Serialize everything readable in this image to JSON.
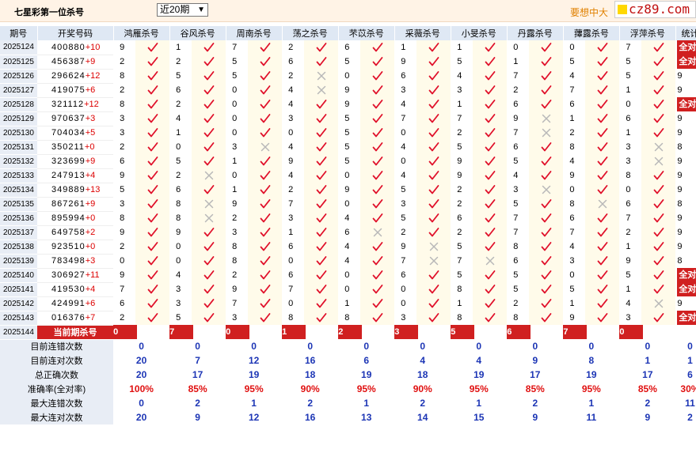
{
  "header": {
    "title": "七星彩第一位杀号",
    "select_value": "近20期",
    "promo": "要想中大",
    "logo": "cz89.com"
  },
  "columns": [
    "期号",
    "开奖号码",
    "鸿雁杀号",
    "谷风杀号",
    "周南杀号",
    "荡之杀号",
    "芣苡杀号",
    "采薇杀号",
    "小旻杀号",
    "丹露杀号",
    "蘀露杀号",
    "浮萍杀号",
    "统计"
  ],
  "rows": [
    {
      "period": "2025124",
      "digits": "400880",
      "sum": "+10",
      "kills": [
        9,
        1,
        7,
        2,
        6,
        1,
        1,
        0,
        0,
        7
      ],
      "ok": [
        1,
        1,
        1,
        1,
        1,
        1,
        1,
        1,
        1,
        1
      ],
      "total": "全对"
    },
    {
      "period": "2025125",
      "digits": "456387",
      "sum": "+9",
      "kills": [
        2,
        2,
        5,
        6,
        5,
        9,
        5,
        1,
        5,
        5
      ],
      "ok": [
        1,
        1,
        1,
        1,
        1,
        1,
        1,
        1,
        1,
        1
      ],
      "total": "全对"
    },
    {
      "period": "2025126",
      "digits": "296624",
      "sum": "+12",
      "kills": [
        8,
        5,
        5,
        2,
        0,
        6,
        4,
        7,
        4,
        5
      ],
      "ok": [
        1,
        1,
        1,
        0,
        1,
        1,
        1,
        1,
        1,
        1
      ],
      "total": "9"
    },
    {
      "period": "2025127",
      "digits": "419075",
      "sum": "+6",
      "kills": [
        2,
        6,
        0,
        4,
        9,
        3,
        3,
        2,
        7,
        1
      ],
      "ok": [
        1,
        1,
        1,
        0,
        1,
        1,
        1,
        1,
        1,
        1
      ],
      "total": "9"
    },
    {
      "period": "2025128",
      "digits": "321112",
      "sum": "+12",
      "kills": [
        8,
        2,
        0,
        4,
        9,
        4,
        1,
        6,
        6,
        0
      ],
      "ok": [
        1,
        1,
        1,
        1,
        1,
        1,
        1,
        1,
        1,
        1
      ],
      "total": "全对"
    },
    {
      "period": "2025129",
      "digits": "970637",
      "sum": "+3",
      "kills": [
        3,
        4,
        0,
        3,
        5,
        7,
        7,
        9,
        1,
        6
      ],
      "ok": [
        1,
        1,
        1,
        1,
        1,
        1,
        1,
        0,
        1,
        1
      ],
      "total": "9"
    },
    {
      "period": "2025130",
      "digits": "704034",
      "sum": "+5",
      "kills": [
        3,
        1,
        0,
        0,
        5,
        0,
        2,
        7,
        2,
        1
      ],
      "ok": [
        1,
        1,
        1,
        1,
        1,
        1,
        1,
        0,
        1,
        1
      ],
      "total": "9"
    },
    {
      "period": "2025131",
      "digits": "350211",
      "sum": "+0",
      "kills": [
        2,
        0,
        3,
        4,
        5,
        4,
        5,
        6,
        8,
        3
      ],
      "ok": [
        1,
        1,
        0,
        1,
        1,
        1,
        1,
        1,
        1,
        0
      ],
      "total": "8"
    },
    {
      "period": "2025132",
      "digits": "323699",
      "sum": "+9",
      "kills": [
        6,
        5,
        1,
        9,
        5,
        0,
        9,
        5,
        4,
        3
      ],
      "ok": [
        1,
        1,
        1,
        1,
        1,
        1,
        1,
        1,
        1,
        0
      ],
      "total": "9"
    },
    {
      "period": "2025133",
      "digits": "247913",
      "sum": "+4",
      "kills": [
        9,
        2,
        0,
        4,
        0,
        4,
        9,
        4,
        9,
        8
      ],
      "ok": [
        1,
        0,
        1,
        1,
        1,
        1,
        1,
        1,
        1,
        1
      ],
      "total": "9"
    },
    {
      "period": "2025134",
      "digits": "349889",
      "sum": "+13",
      "kills": [
        5,
        6,
        1,
        2,
        9,
        5,
        2,
        3,
        0,
        0
      ],
      "ok": [
        1,
        1,
        1,
        1,
        1,
        1,
        1,
        0,
        1,
        1
      ],
      "total": "9"
    },
    {
      "period": "2025135",
      "digits": "867261",
      "sum": "+9",
      "kills": [
        3,
        8,
        9,
        7,
        0,
        3,
        2,
        5,
        8,
        6
      ],
      "ok": [
        1,
        0,
        1,
        1,
        1,
        1,
        1,
        1,
        0,
        1
      ],
      "total": "8"
    },
    {
      "period": "2025136",
      "digits": "895994",
      "sum": "+0",
      "kills": [
        8,
        8,
        2,
        3,
        4,
        5,
        6,
        7,
        6,
        7
      ],
      "ok": [
        1,
        0,
        1,
        1,
        1,
        1,
        1,
        1,
        1,
        1
      ],
      "total": "9"
    },
    {
      "period": "2025137",
      "digits": "649758",
      "sum": "+2",
      "kills": [
        9,
        9,
        3,
        1,
        6,
        2,
        2,
        7,
        7,
        2
      ],
      "ok": [
        1,
        1,
        1,
        1,
        0,
        1,
        1,
        1,
        1,
        1
      ],
      "total": "9"
    },
    {
      "period": "2025138",
      "digits": "923510",
      "sum": "+0",
      "kills": [
        2,
        0,
        8,
        6,
        4,
        9,
        5,
        8,
        4,
        1
      ],
      "ok": [
        1,
        1,
        1,
        1,
        1,
        0,
        1,
        1,
        1,
        1
      ],
      "total": "9"
    },
    {
      "period": "2025139",
      "digits": "783498",
      "sum": "+3",
      "kills": [
        0,
        0,
        8,
        0,
        4,
        7,
        7,
        6,
        3,
        9
      ],
      "ok": [
        1,
        1,
        1,
        1,
        1,
        0,
        0,
        1,
        1,
        1
      ],
      "total": "8"
    },
    {
      "period": "2025140",
      "digits": "306927",
      "sum": "+11",
      "kills": [
        9,
        4,
        2,
        6,
        0,
        6,
        5,
        5,
        0,
        5
      ],
      "ok": [
        1,
        1,
        1,
        1,
        1,
        1,
        1,
        1,
        1,
        1
      ],
      "total": "全对"
    },
    {
      "period": "2025141",
      "digits": "419530",
      "sum": "+4",
      "kills": [
        7,
        3,
        9,
        7,
        0,
        0,
        8,
        5,
        5,
        1
      ],
      "ok": [
        1,
        1,
        1,
        1,
        1,
        1,
        1,
        1,
        1,
        1
      ],
      "total": "全对"
    },
    {
      "period": "2025142",
      "digits": "424991",
      "sum": "+6",
      "kills": [
        6,
        3,
        7,
        0,
        1,
        0,
        1,
        2,
        1,
        4
      ],
      "ok": [
        1,
        1,
        1,
        1,
        1,
        1,
        1,
        1,
        1,
        0
      ],
      "total": "9"
    },
    {
      "period": "2025143",
      "digits": "016376",
      "sum": "+7",
      "kills": [
        2,
        5,
        3,
        8,
        8,
        3,
        8,
        8,
        9,
        3
      ],
      "ok": [
        1,
        1,
        1,
        1,
        1,
        1,
        1,
        1,
        1,
        1
      ],
      "total": "全对"
    }
  ],
  "current": {
    "period": "2025144",
    "label": "当前期杀号",
    "kills": [
      "0",
      "7",
      "0",
      "1",
      "2",
      "3",
      "5",
      "6",
      "7",
      "0"
    ]
  },
  "summary": [
    {
      "label": "目前连错次数",
      "values": [
        "0",
        "0",
        "0",
        "0",
        "0",
        "0",
        "0",
        "0",
        "0",
        "0",
        "0"
      ],
      "style": "v"
    },
    {
      "label": "目前连对次数",
      "values": [
        "20",
        "7",
        "12",
        "16",
        "6",
        "4",
        "4",
        "9",
        "8",
        "1",
        "1"
      ],
      "style": "v"
    },
    {
      "label": "总正确次数",
      "values": [
        "20",
        "17",
        "19",
        "18",
        "19",
        "18",
        "19",
        "17",
        "19",
        "17",
        "6"
      ],
      "style": "v"
    },
    {
      "label": "准确率(全对率)",
      "values": [
        "100%",
        "85%",
        "95%",
        "90%",
        "95%",
        "90%",
        "95%",
        "85%",
        "95%",
        "85%",
        "30%"
      ],
      "style": "r"
    },
    {
      "label": "最大连错次数",
      "values": [
        "0",
        "2",
        "1",
        "2",
        "1",
        "2",
        "1",
        "2",
        "1",
        "2",
        "11"
      ],
      "style": "v"
    },
    {
      "label": "最大连对次数",
      "values": [
        "20",
        "9",
        "12",
        "16",
        "13",
        "14",
        "15",
        "9",
        "11",
        "9",
        "2"
      ],
      "style": "v"
    }
  ],
  "colors": {
    "check": "#e0102a",
    "cross": "#b8b8b8",
    "accent": "#d02020",
    "blue": "#1c35b5"
  }
}
